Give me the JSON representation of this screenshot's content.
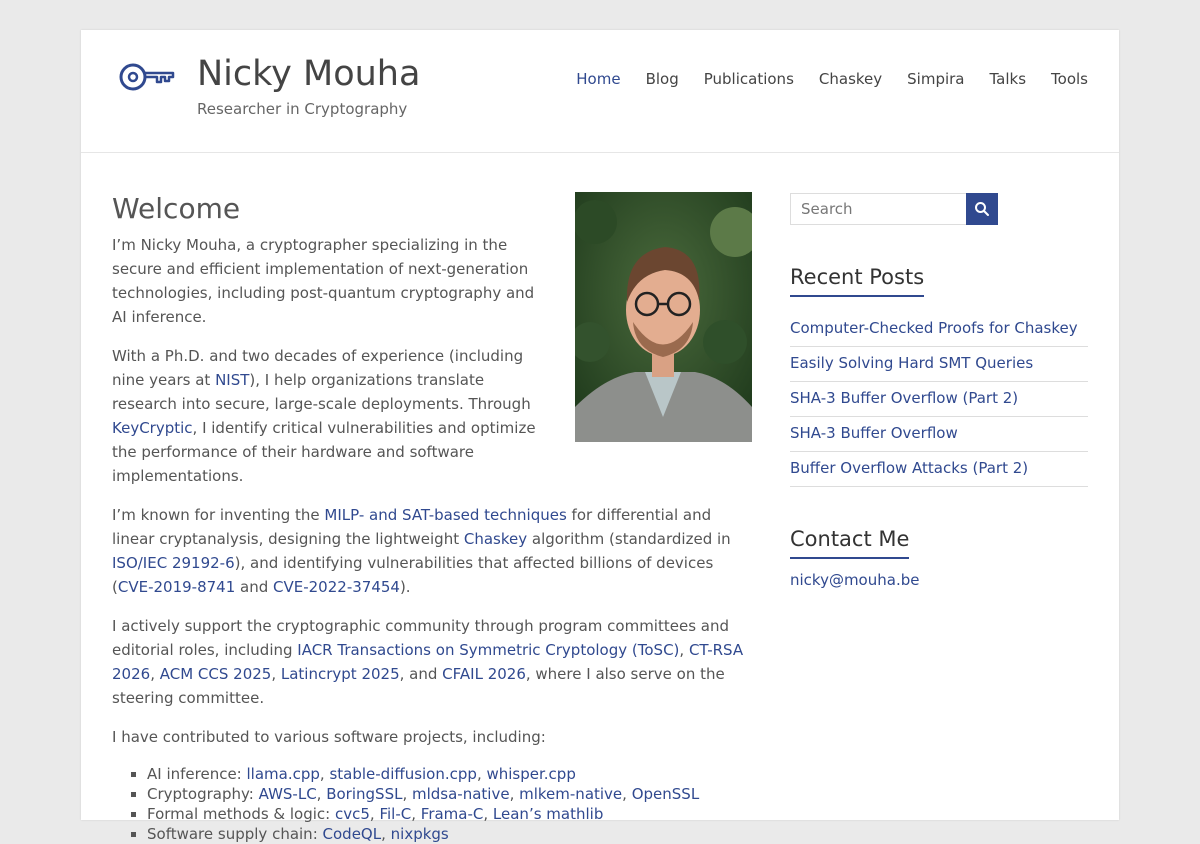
{
  "site": {
    "title": "Nicky Mouha",
    "tagline": "Researcher in Cryptography"
  },
  "nav": [
    "Home",
    "Blog",
    "Publications",
    "Chaskey",
    "Simpira",
    "Talks",
    "Tools"
  ],
  "nav_active": "Home",
  "colors": {
    "accent": "#30498f",
    "text": "#555555",
    "background": "#eaeaea"
  },
  "main": {
    "heading": "Welcome",
    "p1": "I’m Nicky Mouha, a cryptographer specializing in the secure and efficient implementation of next-generation technologies, including post-quantum cryptography and AI inference.",
    "p2": {
      "t1": "With a Ph.D. and two decades of experience (including nine years at ",
      "link_nist": "NIST",
      "t2": "), I help organizations translate research into secure, large-scale deployments. Through ",
      "link_keycryptic": "KeyCryptic",
      "t3": ", I identify critical vulnerabilities and optimize the performance of their hardware and software implementations."
    },
    "p3": {
      "t1": "I’m known for inventing the ",
      "link_milp": "MILP- and SAT-based techniques",
      "t2": " for differential and linear cryptanalysis, designing the lightweight ",
      "link_chaskey": "Chaskey",
      "t3": " algorithm (standardized in ",
      "link_iso": "ISO/IEC 29192-6",
      "t4": "), and identifying vulnerabilities that affected billions of devices (",
      "link_cve1": "CVE-2019-8741",
      "t5": " and ",
      "link_cve2": "CVE-2022-37454",
      "t6": ")."
    },
    "p4": {
      "t1": "I actively support the cryptographic community through program committees and editorial roles, including ",
      "link_tosc": "IACR Transactions on Symmetric Cryptology (ToSC)",
      "s1": ", ",
      "link_ctrsa": "CT-RSA 2026",
      "s2": ", ",
      "link_ccs": "ACM CCS 2025",
      "s3": ", ",
      "link_latin": "Latincrypt 2025",
      "s4": ", and ",
      "link_cfail": "CFAIL 2026",
      "t2": ", where I also serve on the steering committee."
    },
    "p5": "I have contributed to various software projects, including:",
    "projects": [
      {
        "label": "AI inference: ",
        "links": [
          "llama.cpp",
          "stable-diffusion.cpp",
          "whisper.cpp"
        ]
      },
      {
        "label": "Cryptography: ",
        "links": [
          "AWS-LC",
          "BoringSSL",
          "mldsa-native",
          "mlkem-native",
          "OpenSSL"
        ]
      },
      {
        "label": "Formal methods & logic: ",
        "links": [
          "cvc5",
          "Fil-C",
          "Frama-C",
          "Lean’s mathlib"
        ]
      },
      {
        "label": "Software supply chain: ",
        "links": [
          "CodeQL",
          "nixpkgs"
        ]
      }
    ],
    "link_sep": ", "
  },
  "sidebar": {
    "search_placeholder": "Search",
    "recent_title": "Recent Posts",
    "posts": [
      "Computer-Checked Proofs for Chaskey",
      "Easily Solving Hard SMT Queries",
      "SHA-3 Buffer Overflow (Part 2)",
      "SHA-3 Buffer Overflow",
      "Buffer Overflow Attacks (Part 2)"
    ],
    "contact_title": "Contact Me",
    "email": "nicky@mouha.be"
  },
  "icons": {
    "logo": "key-icon",
    "search": "search-icon",
    "portrait": "portrait-photo"
  }
}
